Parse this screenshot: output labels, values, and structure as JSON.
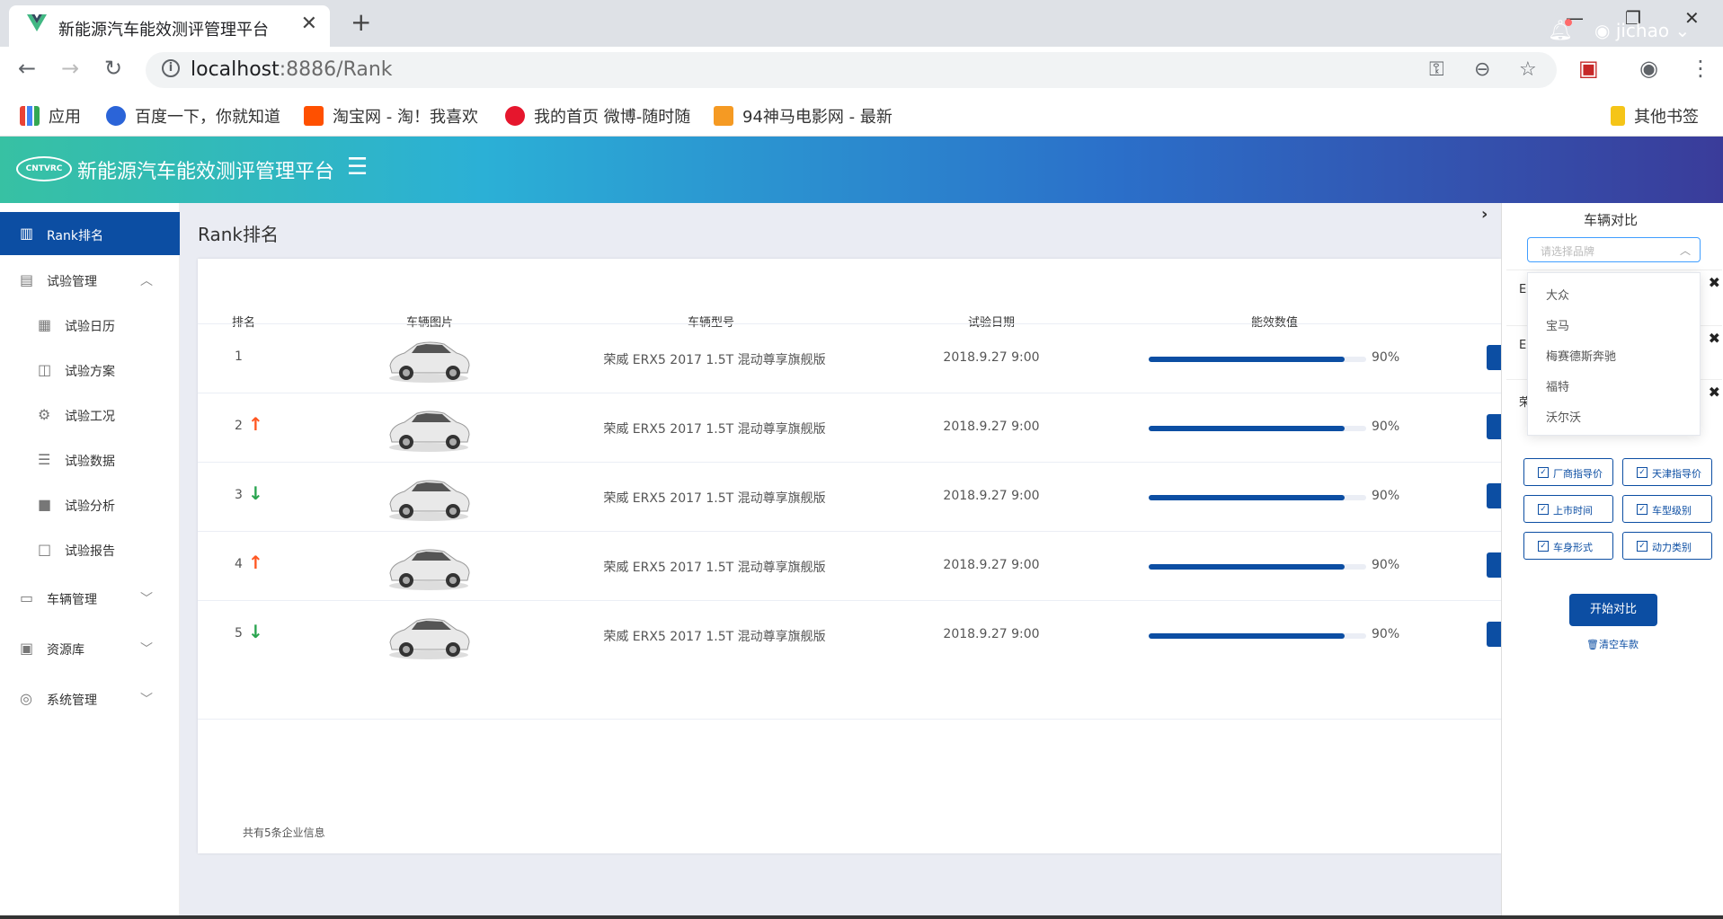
{
  "browser": {
    "tab_title": "新能源汽车能效测评管理平台",
    "url_host": "localhost",
    "url_rest": ":8886/Rank",
    "bookmarks": [
      "应用",
      "百度一下，你就知道",
      "淘宝网 - 淘！我喜欢",
      "我的首页 微博-随时随",
      "94神马电影网 - 最新",
      "其他书签"
    ]
  },
  "header": {
    "logo_text": "CNTVRC",
    "app_title": "新能源汽车能效测评管理平台",
    "username": "jichao"
  },
  "sidebar": {
    "items": [
      {
        "label": "Rank排名"
      },
      {
        "label": "试验管理"
      },
      {
        "label": "试验日历"
      },
      {
        "label": "试验方案"
      },
      {
        "label": "试验工况"
      },
      {
        "label": "试验数据"
      },
      {
        "label": "试验分析"
      },
      {
        "label": "试验报告"
      },
      {
        "label": "车辆管理"
      },
      {
        "label": "资源库"
      },
      {
        "label": "系统管理"
      }
    ]
  },
  "main": {
    "page_title": "Rank排名",
    "columns": [
      "排名",
      "车辆图片",
      "车辆型号",
      "试验日期",
      "能效数值"
    ],
    "rows": [
      {
        "rank": "1",
        "trend": "none",
        "model": "荣威 ERX5 2017 1.5T 混动尊享旗舰版",
        "date": "2018.9.27 9:00",
        "efficiency": 0.9,
        "pct": "90%"
      },
      {
        "rank": "2",
        "trend": "up",
        "model": "荣威 ERX5 2017 1.5T 混动尊享旗舰版",
        "date": "2018.9.27 9:00",
        "efficiency": 0.9,
        "pct": "90%"
      },
      {
        "rank": "3",
        "trend": "down",
        "model": "荣威 ERX5 2017 1.5T 混动尊享旗舰版",
        "date": "2018.9.27 9:00",
        "efficiency": 0.9,
        "pct": "90%"
      },
      {
        "rank": "4",
        "trend": "up",
        "model": "荣威 ERX5 2017 1.5T 混动尊享旗舰版",
        "date": "2018.9.27 9:00",
        "efficiency": 0.9,
        "pct": "90%"
      },
      {
        "rank": "5",
        "trend": "down",
        "model": "荣威 ERX5 2017 1.5T 混动尊享旗舰版",
        "date": "2018.9.27 9:00",
        "efficiency": 0.9,
        "pct": "90%"
      }
    ],
    "total_text": "共有5条企业信息"
  },
  "compare": {
    "title": "车辆对比",
    "select_placeholder": "请选择品牌",
    "brand_options": [
      "大众",
      "宝马",
      "梅赛德斯奔驰",
      "福特",
      "沃尔沃"
    ],
    "slot_labels": [
      "E",
      "E",
      "荣"
    ],
    "checkboxes": [
      "厂商指导价",
      "天津指导价",
      "上市时间",
      "车型级别",
      "车身形式",
      "动力类别"
    ],
    "start_label": "开始对比",
    "clear_label": "清空车款"
  },
  "colors": {
    "primary": "#0c4ea3",
    "up": "#ff5722",
    "down": "#2aa44f"
  }
}
